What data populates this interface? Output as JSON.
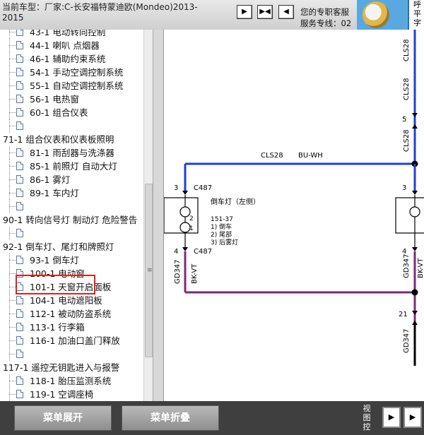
{
  "header": {
    "vehicle_info": "当前车型：厂家:C-长安福特蒙迪欧(Mondeo)2013-2015",
    "service_line1": "您的专职客服",
    "service_line2": "服务专线：02",
    "hotline_chars": "呼\n平\n字"
  },
  "nav_buttons": [
    {
      "glyph": "▶"
    },
    {
      "glyph": "▶◀"
    },
    {
      "glyph": "◀"
    }
  ],
  "tree": {
    "rows": [
      {
        "type": "leaf",
        "label": "43-1 电动转向控制"
      },
      {
        "type": "leaf",
        "label": "44-1 喇叭 点烟器"
      },
      {
        "type": "leaf",
        "label": "46-1 辅助约束系统"
      },
      {
        "type": "leaf",
        "label": "54-1 手动空调控制系统"
      },
      {
        "type": "leaf",
        "label": "55-1 自动空调控制系统"
      },
      {
        "type": "leaf",
        "label": "56-1 电热窗"
      },
      {
        "type": "leaf",
        "label": "60-1 组合仪表"
      },
      {
        "type": "empty",
        "label": ""
      },
      {
        "type": "group",
        "label": "71-1 组合仪表和仪表板照明"
      },
      {
        "type": "leaf",
        "label": "81-1 雨刮器与洗涤器"
      },
      {
        "type": "leaf",
        "label": "85-1 前照灯 自动大灯"
      },
      {
        "type": "leaf",
        "label": "86-1 雾灯"
      },
      {
        "type": "leaf",
        "label": "89-1 车内灯"
      },
      {
        "type": "empty",
        "label": ""
      },
      {
        "type": "group",
        "label": "90-1 转向信号灯 制动灯 危险警告"
      },
      {
        "type": "empty",
        "label": ""
      },
      {
        "type": "group",
        "label": "92-1 倒车灯、尾灯和牌照灯"
      },
      {
        "type": "leaf",
        "label": "93-1 倒车灯"
      },
      {
        "type": "leaf",
        "label": "100-1 电动窗"
      },
      {
        "type": "leaf",
        "label": "101-1 天窗开启面板"
      },
      {
        "type": "leaf",
        "label": "104-1 电动遮阳板"
      },
      {
        "type": "leaf",
        "label": "112-1 被动防盗系统"
      },
      {
        "type": "leaf",
        "label": "113-1 行李箱"
      },
      {
        "type": "leaf",
        "label": "116-1 加油口盖门释放"
      },
      {
        "type": "empty",
        "label": ""
      },
      {
        "type": "group",
        "label": "117-1 遥控无钥匙进入与报警"
      },
      {
        "type": "leaf",
        "label": "118-1 胎压监测系统"
      },
      {
        "type": "leaf",
        "label": "119-1 空调座椅"
      }
    ],
    "selected": "93-1 倒车灯"
  },
  "diagram": {
    "wire_top_label": "CLS28",
    "wire_top_color": "BU-WH",
    "pin_3": "3",
    "pin_4": "4",
    "pin_5": "5",
    "pin_21": "21",
    "connector": "C487",
    "lamp_title": "倒车灯（左侧）",
    "lamp_code": "151-37",
    "lamp_line1": "1) 倒车",
    "lamp_line2": "2) 尾部",
    "lamp_line3": "3) 后雾灯",
    "pin_2": "2",
    "pin_1": "1",
    "ground_wire": "GD347",
    "ground_color": "BK-VT",
    "colors": {
      "blue": "#1f3fd6",
      "purple": "#7a2b7a",
      "black": "#000000"
    }
  },
  "bottom": {
    "expand_label": "菜单展开",
    "collapse_label": "菜单折叠",
    "view_label": "视图控",
    "view_buttons": [
      {
        "glyph": "▶"
      },
      {
        "glyph": "▶"
      }
    ]
  }
}
